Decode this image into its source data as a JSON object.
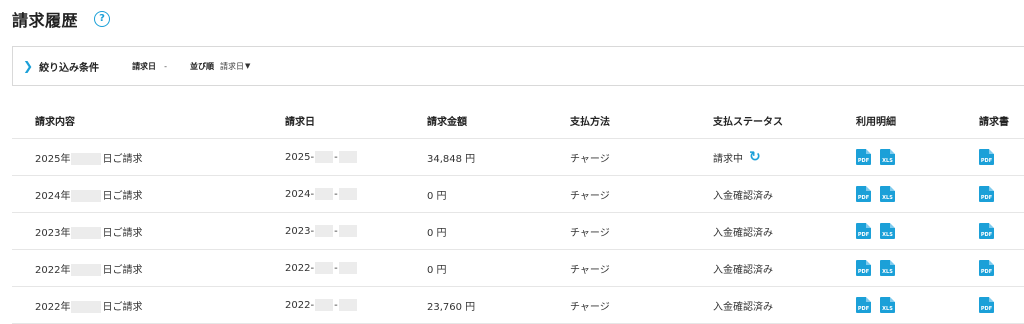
{
  "page": {
    "title": "請求履歴",
    "help_icon": "?"
  },
  "filter": {
    "toggle_icon": "❯",
    "title": "絞り込み条件",
    "date_label": "請求日",
    "date_value": "-",
    "sort_label": "並び順",
    "sort_value": "請求日",
    "sort_caret": "▼"
  },
  "table": {
    "headers": [
      "請求内容",
      "請求日",
      "請求金額",
      "支払方法",
      "支払ステータス",
      "利用明細",
      "請求書"
    ],
    "rows": [
      {
        "content_prefix": "2025年",
        "content_suffix": "日ご請求",
        "date_prefix": "2025-",
        "date_sep": "-",
        "amount": "34,848 円",
        "method": "チャージ",
        "status": "請求中",
        "has_refresh": true,
        "has_xls": true
      },
      {
        "content_prefix": "2024年",
        "content_suffix": "日ご請求",
        "date_prefix": "2024-",
        "date_sep": "-",
        "amount": "0 円",
        "method": "チャージ",
        "status": "入金確認済み",
        "has_refresh": false,
        "has_xls": true
      },
      {
        "content_prefix": "2023年",
        "content_suffix": "日ご請求",
        "date_prefix": "2023-",
        "date_sep": "-",
        "amount": "0 円",
        "method": "チャージ",
        "status": "入金確認済み",
        "has_refresh": false,
        "has_xls": true
      },
      {
        "content_prefix": "2022年",
        "content_suffix": "日ご請求",
        "date_prefix": "2022-",
        "date_sep": "-",
        "amount": "0 円",
        "method": "チャージ",
        "status": "入金確認済み",
        "has_refresh": false,
        "has_xls": true
      },
      {
        "content_prefix": "2022年",
        "content_suffix": "日ご請求",
        "date_prefix": "2022-",
        "date_sep": "-",
        "amount": "23,760 円",
        "method": "チャージ",
        "status": "入金確認済み",
        "has_refresh": false,
        "has_xls": true
      }
    ]
  },
  "icons": {
    "pdf": "PDF",
    "xls": "XLS",
    "refresh": "↻"
  },
  "colors": {
    "accent": "#1ba0d8",
    "redacted": "#ececec",
    "border": "#e6e6e6"
  }
}
